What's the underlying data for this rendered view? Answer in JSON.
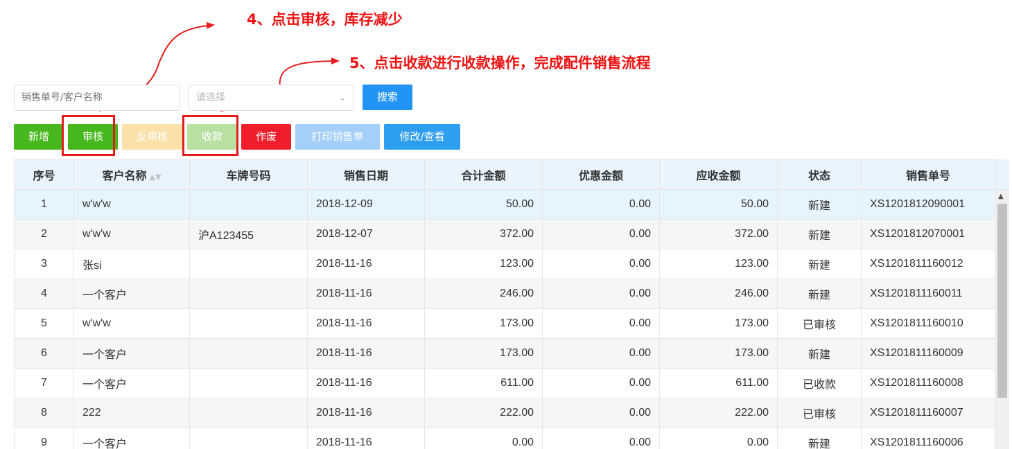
{
  "annotations": {
    "step4": "4、点击审核，库存减少",
    "step5": "5、点击收款进行收款操作，完成配件销售流程"
  },
  "search": {
    "placeholder": "销售单号/客户名称",
    "select_placeholder": "请选择",
    "button": "搜索"
  },
  "toolbar": {
    "add": "新增",
    "audit": "审核",
    "unaudit": "反审核",
    "collect": "收款",
    "void": "作废",
    "print": "打印销售单",
    "edit": "修改/查看"
  },
  "colors": {
    "annotation": "#ee1111",
    "green": "#46b71d",
    "blue": "#2294f5",
    "red": "#f01e2c",
    "header_bg": "#e9f4fc"
  },
  "table": {
    "columns": [
      "序号",
      "客户名称",
      "车牌号码",
      "销售日期",
      "合计金额",
      "优惠金额",
      "应收金额",
      "状态",
      "销售单号"
    ],
    "rows": [
      [
        "1",
        "w'w'w",
        "",
        "2018-12-09",
        "50.00",
        "0.00",
        "50.00",
        "新建",
        "XS1201812090001"
      ],
      [
        "2",
        "w'w'w",
        "沪A123455",
        "2018-12-07",
        "372.00",
        "0.00",
        "372.00",
        "新建",
        "XS1201812070001"
      ],
      [
        "3",
        "张si",
        "",
        "2018-11-16",
        "123.00",
        "0.00",
        "123.00",
        "新建",
        "XS1201811160012"
      ],
      [
        "4",
        "一个客户",
        "",
        "2018-11-16",
        "246.00",
        "0.00",
        "246.00",
        "新建",
        "XS1201811160011"
      ],
      [
        "5",
        "w'w'w",
        "",
        "2018-11-16",
        "173.00",
        "0.00",
        "173.00",
        "已审核",
        "XS1201811160010"
      ],
      [
        "6",
        "一个客户",
        "",
        "2018-11-16",
        "173.00",
        "0.00",
        "173.00",
        "新建",
        "XS1201811160009"
      ],
      [
        "7",
        "一个客户",
        "",
        "2018-11-16",
        "611.00",
        "0.00",
        "611.00",
        "已收款",
        "XS1201811160008"
      ],
      [
        "8",
        "222",
        "",
        "2018-11-16",
        "222.00",
        "0.00",
        "222.00",
        "已审核",
        "XS1201811160007"
      ],
      [
        "9",
        "一个客户",
        "",
        "2018-11-16",
        "0.00",
        "0.00",
        "0.00",
        "新建",
        "XS1201811160006"
      ]
    ]
  }
}
